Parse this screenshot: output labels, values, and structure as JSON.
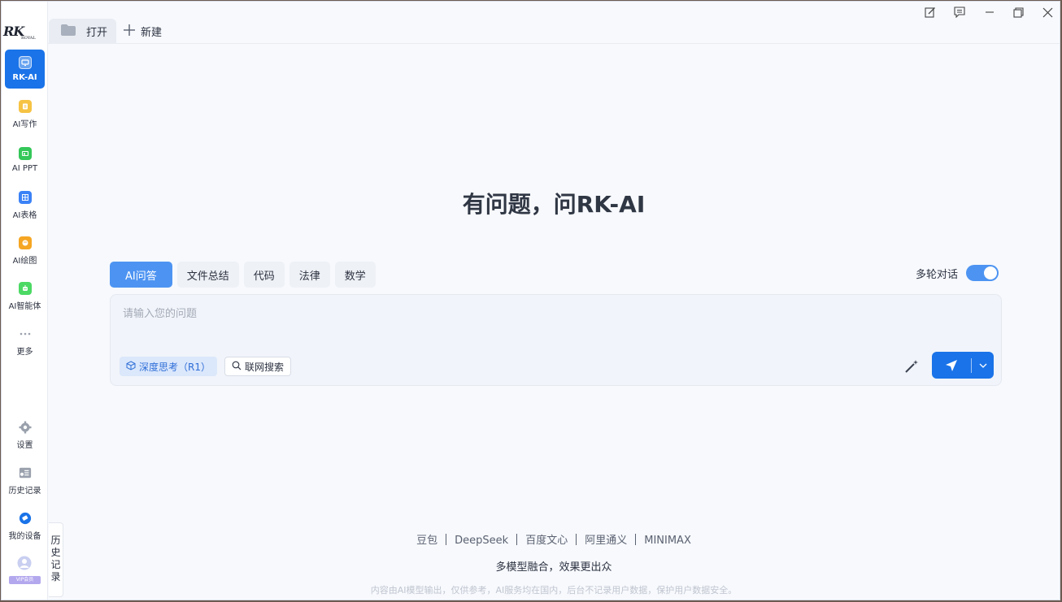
{
  "app": {
    "logo_text": "RK",
    "logo_small": "ROYAL"
  },
  "sidebar": {
    "items": [
      {
        "label": "RK-AI",
        "icon": "rk-ai-icon",
        "active": true,
        "color": "#1a73e8"
      },
      {
        "label": "AI写作",
        "icon": "writing-icon",
        "color": "#f6c343"
      },
      {
        "label": "AI PPT",
        "icon": "ppt-icon",
        "color": "#34c759"
      },
      {
        "label": "AI表格",
        "icon": "table-icon",
        "color": "#3b82f6"
      },
      {
        "label": "AI绘图",
        "icon": "palette-icon",
        "color": "#f5a623"
      },
      {
        "label": "AI智能体",
        "icon": "agent-icon",
        "color": "#4cd964"
      },
      {
        "label": "更多",
        "icon": "more-icon"
      }
    ],
    "bottom": [
      {
        "label": "设置",
        "icon": "gear-icon"
      },
      {
        "label": "历史记录",
        "icon": "history-icon"
      },
      {
        "label": "我的设备",
        "icon": "device-icon"
      }
    ],
    "vip_badge": "VIP会员"
  },
  "topbar": {
    "open_label": "打开",
    "new_label": "新建"
  },
  "main": {
    "headline": "有问题，问RK-AI",
    "mode_tabs": [
      "AI问答",
      "文件总结",
      "代码",
      "法律",
      "数学"
    ],
    "multi_turn_label": "多轮对话",
    "input_placeholder": "请输入您的问题",
    "deep_think_label": "深度思考（R1）",
    "web_search_label": "联网搜索"
  },
  "history_tab": [
    "历",
    "史",
    "记",
    "录"
  ],
  "footer": {
    "models": [
      "豆包",
      "DeepSeek",
      "百度文心",
      "阿里通义",
      "MINIMAX"
    ],
    "slogan": "多模型融合，效果更出众",
    "disclaimer": "内容由AI模型输出，仅供参考，AI服务均在国内，后台不记录用户数据，保护用户数据安全。"
  },
  "colors": {
    "accent": "#1a73e8",
    "tab_active": "#4d94f2"
  }
}
